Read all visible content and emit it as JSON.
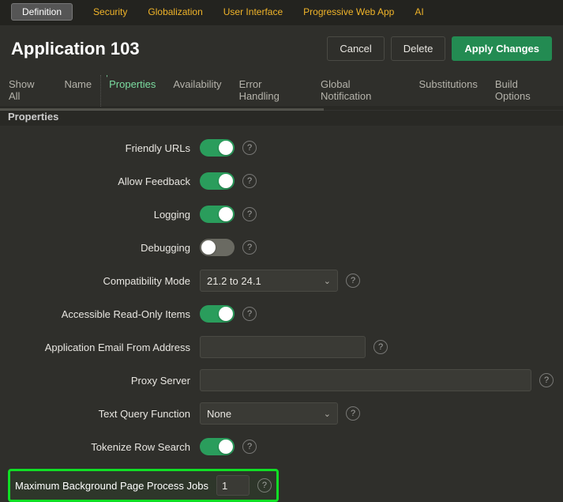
{
  "topnav": {
    "tabs": [
      {
        "label": "Definition",
        "active": true
      },
      {
        "label": "Security"
      },
      {
        "label": "Globalization"
      },
      {
        "label": "User Interface"
      },
      {
        "label": "Progressive Web App"
      },
      {
        "label": "AI"
      }
    ]
  },
  "title": "Application 103",
  "actions": {
    "cancel": "Cancel",
    "delete": "Delete",
    "apply": "Apply Changes"
  },
  "subtabs": [
    {
      "label": "Show All"
    },
    {
      "label": "Name"
    },
    {
      "label": "Properties",
      "active": true
    },
    {
      "label": "Availability"
    },
    {
      "label": "Error Handling"
    },
    {
      "label": "Global Notification"
    },
    {
      "label": "Substitutions"
    },
    {
      "label": "Build Options"
    }
  ],
  "section_title": "Properties",
  "form": {
    "friendly_urls": {
      "label": "Friendly URLs",
      "value": true
    },
    "allow_feedback": {
      "label": "Allow Feedback",
      "value": true
    },
    "logging": {
      "label": "Logging",
      "value": true
    },
    "debugging": {
      "label": "Debugging",
      "value": false
    },
    "compat_mode": {
      "label": "Compatibility Mode",
      "value": "21.2 to 24.1"
    },
    "accessible_ro": {
      "label": "Accessible Read-Only Items",
      "value": true
    },
    "email_from": {
      "label": "Application Email From Address",
      "value": ""
    },
    "proxy": {
      "label": "Proxy Server",
      "value": ""
    },
    "text_query_fn": {
      "label": "Text Query Function",
      "value": "None"
    },
    "tokenize_row_search": {
      "label": "Tokenize Row Search",
      "value": true
    },
    "max_bg_jobs": {
      "label": "Maximum Background Page Process Jobs",
      "value": "1"
    }
  },
  "glyphs": {
    "help": "?",
    "chev": "⌄"
  }
}
